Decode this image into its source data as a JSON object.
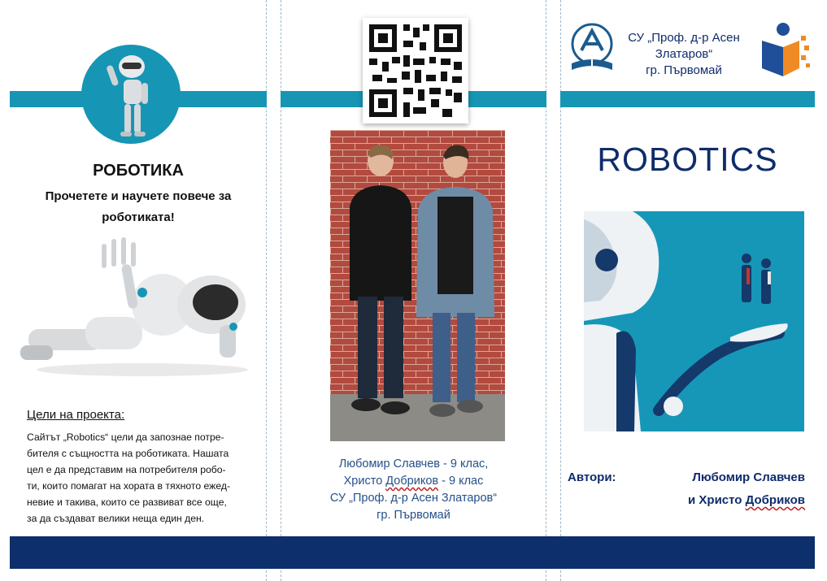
{
  "left_panel": {
    "title": "РОБОТИКА",
    "lead_line1": "Прочетете и научете повече за",
    "lead_line2": "роботиката!",
    "goals_heading": "Цели на проекта:",
    "goals_lines": [
      "Сайтът „Robotics“ цели да запознае потре-",
      "бителя с същността на роботиката. Нашата",
      "цел е да представим на потребителя робо-",
      "ти, които помагат на хората в тяхното ежед-",
      "невие и такива, които се развиват все още,",
      "за да създават велики неща един ден."
    ]
  },
  "middle_panel": {
    "caption_line1": "Любомир Славчев -  9 клас,",
    "caption_line2_pre": "Христо ",
    "caption_line2_word": "Добриков",
    "caption_line2_post": "  - 9 клас",
    "caption_line3": "СУ „Проф. д-р Асен Златаров“",
    "caption_line4": "гр. Първомай"
  },
  "right_panel": {
    "school_line1": "СУ „Проф. д-р Асен",
    "school_line2": "Златаров“",
    "school_line3": "гр. Първомай",
    "title": "ROBOTICS",
    "authors_label": "Автори:",
    "author1": "Любомир Славчев",
    "author2_pre": "и  Христо ",
    "author2_word": "Добриков"
  },
  "colors": {
    "teal": "#1696b4",
    "navy": "#0d2f6b",
    "text_blue": "#25508a"
  }
}
